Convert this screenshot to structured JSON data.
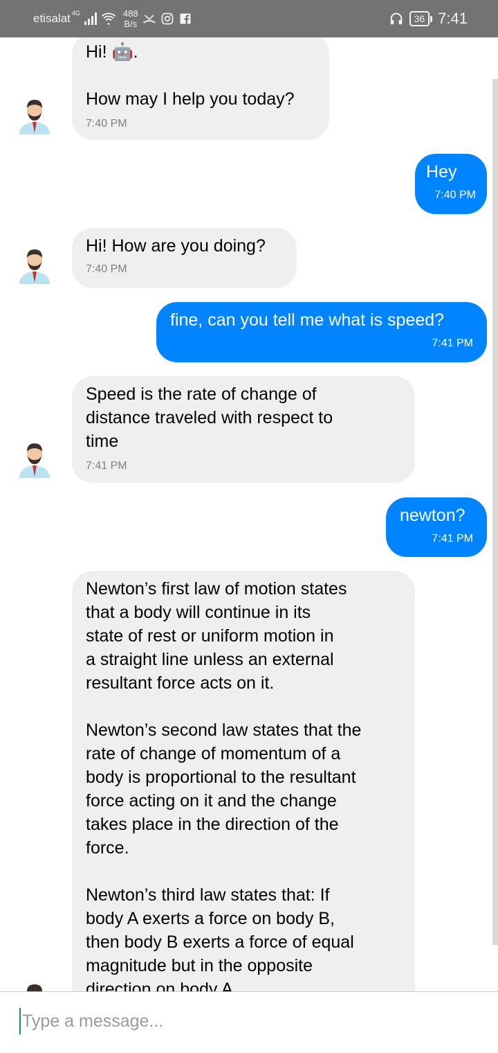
{
  "status_bar": {
    "carrier": "etisalat",
    "network": "4G",
    "net_speed_value": "488",
    "net_speed_unit": "B/s",
    "battery": "36",
    "time": "7:41"
  },
  "messages": [
    {
      "sender": "bot",
      "text": "Hi! 🤖.\n\nHow may I help you today?",
      "time": "7:40 PM"
    },
    {
      "sender": "user",
      "text": "Hey",
      "time": "7:40 PM"
    },
    {
      "sender": "bot",
      "text": "Hi! How are you doing?",
      "time": "7:40 PM"
    },
    {
      "sender": "user",
      "text": "fine, can you tell me what is speed?",
      "time": "7:41 PM"
    },
    {
      "sender": "bot",
      "text": "Speed is the rate of change of\ndistance traveled with respect to\ntime",
      "time": "7:41 PM"
    },
    {
      "sender": "user",
      "text": "newton?",
      "time": "7:41 PM"
    },
    {
      "sender": "bot",
      "text": "Newton’s first law of motion states\nthat a body will continue in its\nstate of rest or uniform motion in\na straight line unless an external\nresultant force acts on it.\n\nNewton’s second law states that the\nrate of change of momentum of a\nbody is proportional to the resultant\nforce acting on it and the change\ntakes place in the direction of the\nforce.\n\nNewton’s third law states that: If\nbody A exerts a force on body B,\nthen body B exerts a force of equal\nmagnitude but in the opposite\ndirection on body A.",
      "time": ""
    }
  ],
  "composer": {
    "placeholder": "Type a message..."
  },
  "colors": {
    "user_bubble": "#0084ff",
    "bot_bubble": "#efefef",
    "status_bar": "#737373",
    "cursor": "#0b8a7e"
  }
}
